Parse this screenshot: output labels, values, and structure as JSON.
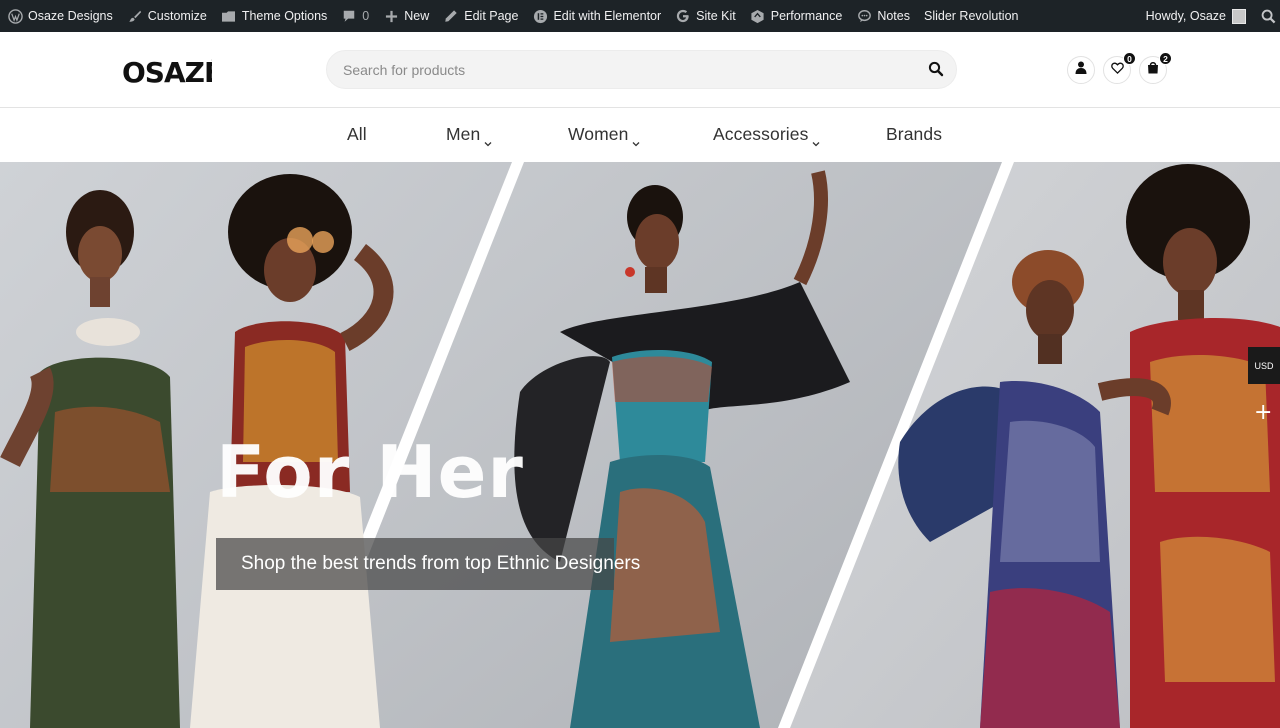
{
  "adminbar": {
    "site_name": "Osaze Designs",
    "customize": "Customize",
    "theme_options": "Theme Options",
    "comments_count": "0",
    "new": "New",
    "edit_page": "Edit Page",
    "edit_elementor": "Edit with Elementor",
    "site_kit": "Site Kit",
    "performance": "Performance",
    "notes": "Notes",
    "slider_revolution": "Slider Revolution",
    "howdy": "Howdy, Osaze"
  },
  "header": {
    "logo_text": "OSAZÉ",
    "search_placeholder": "Search for products",
    "wishlist_count": "0",
    "cart_count": "2"
  },
  "nav": {
    "items": [
      {
        "label": "All"
      },
      {
        "label": "Men"
      },
      {
        "label": "Women"
      },
      {
        "label": "Accessories"
      },
      {
        "label": "Brands"
      }
    ]
  },
  "hero": {
    "title": "For Her",
    "subtitle": "Shop the best trends from top Ethnic Designers"
  },
  "currency": "USD",
  "colors": {
    "adminbar_bg": "#1d2327",
    "accent_dark": "#111111",
    "hero_bg": "#c9ccd1"
  },
  "icons": [
    "wordpress-icon",
    "brush-icon",
    "folder-icon",
    "comment-icon",
    "plus-icon",
    "pencil-icon",
    "elementor-icon",
    "google-g-icon",
    "performance-icon",
    "notes-icon",
    "user-icon",
    "heart-icon",
    "bag-icon",
    "search-icon",
    "chevron-down-icon"
  ]
}
